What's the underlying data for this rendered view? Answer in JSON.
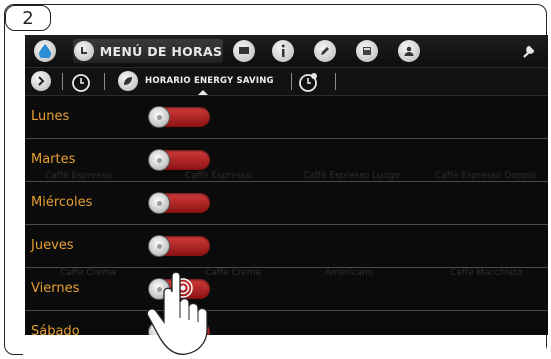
{
  "step_number": "2",
  "header": {
    "active_tab_label": "MENÚ DE HORAS",
    "icons": [
      "water-drop-icon",
      "clock-icon",
      "flag-icon",
      "info-icon",
      "edit-icon",
      "calculator-icon",
      "user-icon",
      "wrench-icon"
    ]
  },
  "subbar": {
    "label": "HORARIO ENERGY SAVING",
    "icons": [
      "arrow-right-icon",
      "clock-settings-icon",
      "leaf-icon",
      "refresh-clock-icon"
    ]
  },
  "days": [
    {
      "label": "Lunes",
      "enabled": false
    },
    {
      "label": "Martes",
      "enabled": false
    },
    {
      "label": "Miércoles",
      "enabled": false
    },
    {
      "label": "Jueves",
      "enabled": false
    },
    {
      "label": "Viernes",
      "enabled": false
    },
    {
      "label": "Sábado",
      "enabled": false
    }
  ],
  "background_labels": [
    "Caffè Espresso",
    "Caffè Espresso",
    "Caffè Espresso Lungo",
    "Caffè Espresso Doppio",
    "Caffè Crema",
    "Caffè Crema",
    "Americano",
    "Caffè Macchiato"
  ],
  "colors": {
    "day_label": "#e8a032",
    "toggle_off": "#c03030",
    "screen_bg": "#0b0b0b"
  }
}
